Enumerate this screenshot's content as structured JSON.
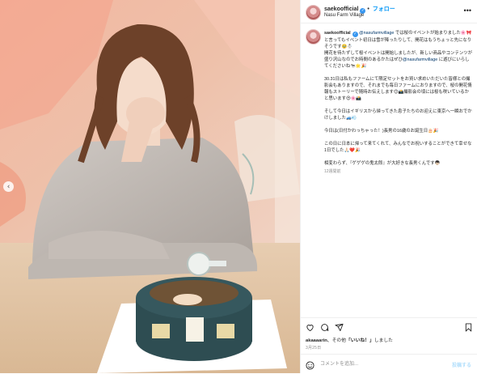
{
  "post": {
    "username": "saekoofficial",
    "follow_label": "フォロー",
    "location": "Nasu Farm Village",
    "caption": {
      "username": "saekoofficial",
      "mention": "@nasufarmvillage",
      "line1": " では桜のイベントが始まりました🌸🎀",
      "line2": "と言ってもイベント初日は雪が降ったりして、開花はもうちょっと先になりそうです🥹☃️",
      "line3": "開花を待たずして桜イベントは開始しましたが、新しい商品やコンテンツが盛り沢山なのでお時間のあるかたはぜひ",
      "mention2": "@nasufarmvillage",
      "line4": " に遊びにいらしてくださいね🐄🌟🎉",
      "para2": "30.31日は私もファームにて限定セットをお買い求めいただいた皆様との撮影会もありますので、それまでも毎日ファームにおりますので、桜の開花情報もストーリーで随時お伝えします😊📸撮影会の頃には桜も咲いているかと思います😍🌸📸",
      "para3": "そして今日はイギリスから帰ってきた息子たちのお迎えに東京へ一瞬おでかけしました🚙💨",
      "para4": "今日は(日付かわっちゃった！)長男の16歳のお誕生日🎂🎉",
      "para5": "この日に日本に帰って来てくれて、みんなでお祝いすることができて幸せな1日でした🙏🏻❤️🎉",
      "para6": "相変わらず、『ゲゲゲの鬼太郎』が大好きな長男くんです👦🏻",
      "time": "12週間前"
    },
    "likes": {
      "user": "akaaaarin",
      "rest": "、その他",
      "quoted": "「いいね！」",
      "suffix": "しました"
    },
    "date": "3月25日",
    "comment_placeholder": "コメントを追加...",
    "post_button": "投稿する",
    "icons": [
      "more-icon",
      "heart-icon",
      "comment-icon",
      "share-icon",
      "bookmark-icon",
      "emoji-icon",
      "chevron-left-icon"
    ],
    "colors": {
      "link": "#00376b",
      "accent": "#0095f6",
      "muted": "#8e8e8e",
      "border": "#efefef"
    }
  }
}
